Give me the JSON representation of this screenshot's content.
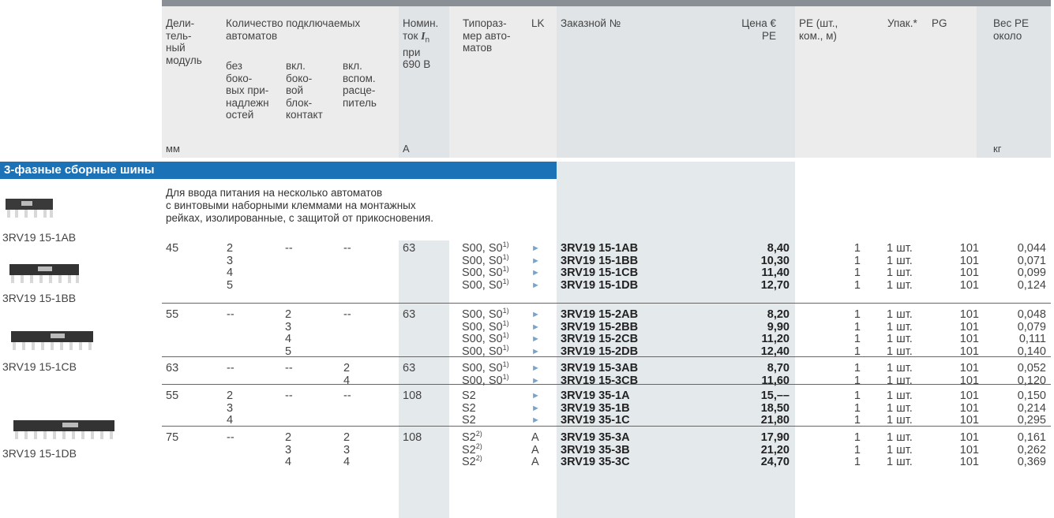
{
  "headers": {
    "divider": [
      "Дели-",
      "тель-",
      "ный",
      "модуль"
    ],
    "count_title": [
      "Количество подключаемых",
      "автоматов"
    ],
    "sub_without": [
      "без",
      "боко-",
      "вых при-",
      "надлежн",
      "остей"
    ],
    "sub_aux": [
      "вкл.",
      "боко-",
      "вой",
      "блок-",
      "контакт"
    ],
    "sub_shunt": [
      "вкл.",
      "вспом.",
      "расце-",
      "питель"
    ],
    "current": [
      "Номин.",
      "ток",
      "при",
      "690 В"
    ],
    "current_symbol": "I",
    "current_sub": "n",
    "size": [
      "Типораз-",
      "мер авто-",
      "матов"
    ],
    "lk": "LK",
    "order_no": "Заказной №",
    "price": [
      "Цена €",
      "PE"
    ],
    "pe": [
      "PE (шт.,",
      "ком., м)"
    ],
    "pack": "Упак.*",
    "pg": "PG",
    "weight": [
      "Вес PE",
      "около"
    ]
  },
  "units": {
    "divider": "мм",
    "current": "A",
    "weight": "кг"
  },
  "section_title": "3-фазные сборные шины",
  "description": [
    "Для ввода питания на несколько автоматов",
    "с винтовыми наборными клеммами на монтажных",
    "рейках, изолированные, с защитой от прикосновения."
  ],
  "image_labels": [
    "3RV19 15-1AB",
    "3RV19 15-1BB",
    "3RV19 15-1CB",
    "3RV19 15-1DB"
  ],
  "groups": [
    {
      "divider": "45",
      "without": [
        "2",
        "3",
        "4",
        "5"
      ],
      "aux": [
        "--"
      ],
      "shunt": [
        "--"
      ],
      "current": "63",
      "rows": [
        {
          "size": "S00, S0",
          "sup": "1)",
          "lk": "►",
          "order": "3RV19 15-1AB",
          "price": "8,40",
          "pe": "1",
          "pack": "1 шт.",
          "pg": "101",
          "weight": "0,044"
        },
        {
          "size": "S00, S0",
          "sup": "1)",
          "lk": "►",
          "order": "3RV19 15-1BB",
          "price": "10,30",
          "pe": "1",
          "pack": "1 шт.",
          "pg": "101",
          "weight": "0,071"
        },
        {
          "size": "S00, S0",
          "sup": "1)",
          "lk": "►",
          "order": "3RV19 15-1CB",
          "price": "11,40",
          "pe": "1",
          "pack": "1 шт.",
          "pg": "101",
          "weight": "0,099"
        },
        {
          "size": "S00, S0",
          "sup": "1)",
          "lk": "►",
          "order": "3RV19 15-1DB",
          "price": "12,70",
          "pe": "1",
          "pack": "1 шт.",
          "pg": "101",
          "weight": "0,124"
        }
      ]
    },
    {
      "divider": "55",
      "without": [
        "--"
      ],
      "aux": [
        "2",
        "3",
        "4",
        "5"
      ],
      "shunt": [
        "--"
      ],
      "current": "63",
      "rows": [
        {
          "size": "S00, S0",
          "sup": "1)",
          "lk": "►",
          "order": "3RV19 15-2AB",
          "price": "8,20",
          "pe": "1",
          "pack": "1 шт.",
          "pg": "101",
          "weight": "0,048"
        },
        {
          "size": "S00, S0",
          "sup": "1)",
          "lk": "►",
          "order": "3RV19 15-2BB",
          "price": "9,90",
          "pe": "1",
          "pack": "1 шт.",
          "pg": "101",
          "weight": "0,079"
        },
        {
          "size": "S00, S0",
          "sup": "1)",
          "lk": "►",
          "order": "3RV19 15-2CB",
          "price": "11,20",
          "pe": "1",
          "pack": "1 шт.",
          "pg": "101",
          "weight": "0,111"
        },
        {
          "size": "S00, S0",
          "sup": "1)",
          "lk": "►",
          "order": "3RV19 15-2DB",
          "price": "12,40",
          "pe": "1",
          "pack": "1 шт.",
          "pg": "101",
          "weight": "0,140"
        }
      ]
    },
    {
      "divider": "63",
      "without": [
        "--"
      ],
      "aux": [
        "--"
      ],
      "shunt": [
        "2",
        "4"
      ],
      "current": "63",
      "rows": [
        {
          "size": "S00, S0",
          "sup": "1)",
          "lk": "►",
          "order": "3RV19 15-3AB",
          "price": "8,70",
          "pe": "1",
          "pack": "1 шт.",
          "pg": "101",
          "weight": "0,052"
        },
        {
          "size": "S00, S0",
          "sup": "1)",
          "lk": "►",
          "order": "3RV19 15-3CB",
          "price": "11,60",
          "pe": "1",
          "pack": "1 шт.",
          "pg": "101",
          "weight": "0,120"
        }
      ]
    },
    {
      "divider": "55",
      "without": [
        "2",
        "3",
        "4"
      ],
      "aux": [
        "--"
      ],
      "shunt": [
        "--"
      ],
      "current": "108",
      "rows": [
        {
          "size": "S2",
          "sup": "",
          "lk": "►",
          "order": "3RV19 35-1A",
          "price": "15,––",
          "pe": "1",
          "pack": "1 шт.",
          "pg": "101",
          "weight": "0,150"
        },
        {
          "size": "S2",
          "sup": "",
          "lk": "►",
          "order": "3RV19 35-1B",
          "price": "18,50",
          "pe": "1",
          "pack": "1 шт.",
          "pg": "101",
          "weight": "0,214"
        },
        {
          "size": "S2",
          "sup": "",
          "lk": "►",
          "order": "3RV19 35-1C",
          "price": "21,80",
          "pe": "1",
          "pack": "1 шт.",
          "pg": "101",
          "weight": "0,295"
        }
      ]
    },
    {
      "divider": "75",
      "without": [
        "--"
      ],
      "aux": [
        "2",
        "3",
        "4"
      ],
      "shunt": [
        "2",
        "3",
        "4"
      ],
      "current": "108",
      "rows": [
        {
          "size": "S2",
          "sup": "2)",
          "lk": "A",
          "order": "3RV19 35-3A",
          "price": "17,90",
          "pe": "1",
          "pack": "1 шт.",
          "pg": "101",
          "weight": "0,161"
        },
        {
          "size": "S2",
          "sup": "2)",
          "lk": "A",
          "order": "3RV19 35-3B",
          "price": "21,20",
          "pe": "1",
          "pack": "1 шт.",
          "pg": "101",
          "weight": "0,262"
        },
        {
          "size": "S2",
          "sup": "2)",
          "lk": "A",
          "order": "3RV19 35-3C",
          "price": "24,70",
          "pe": "1",
          "pack": "1 шт.",
          "pg": "101",
          "weight": "0,369"
        }
      ]
    }
  ]
}
